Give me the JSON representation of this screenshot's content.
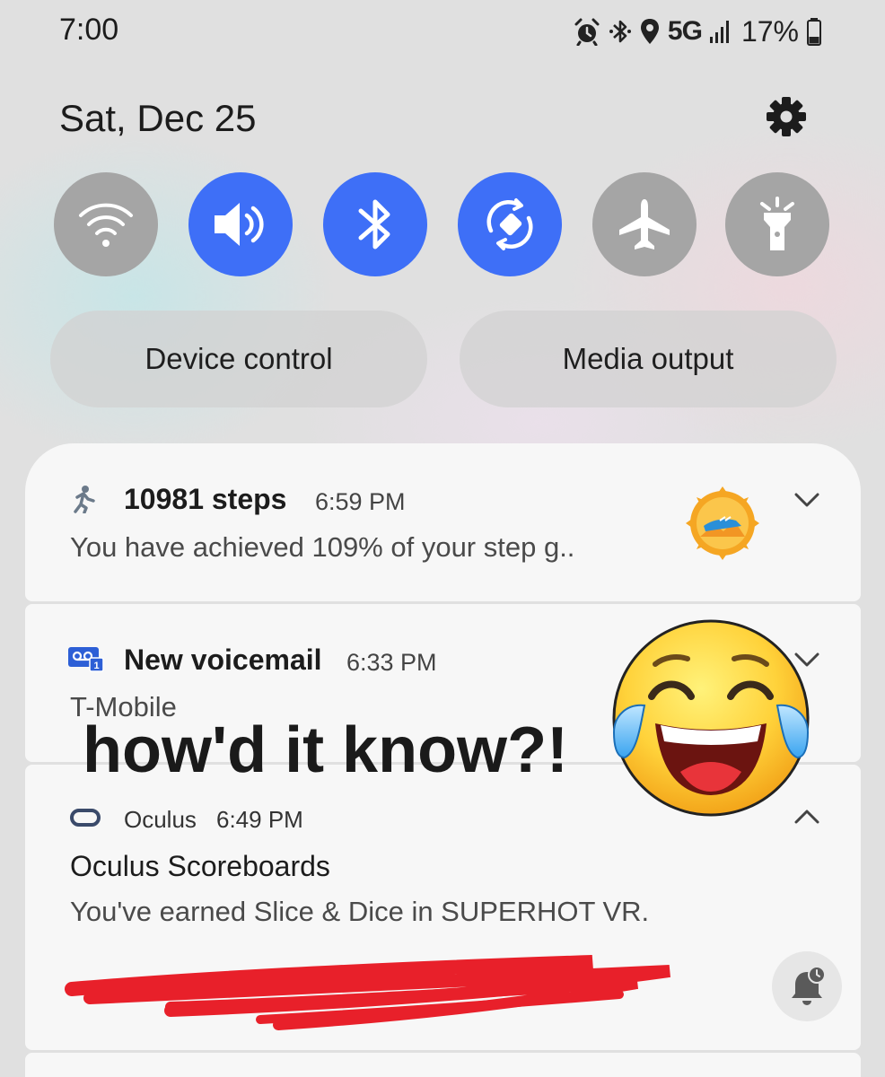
{
  "status_bar": {
    "time": "7:00",
    "network_type": "5G",
    "battery_percent": "17%",
    "icons": [
      "alarm-icon",
      "bluetooth-icon",
      "location-icon",
      "signal-icon",
      "battery-icon"
    ]
  },
  "header": {
    "date": "Sat, Dec 25",
    "settings_icon": "gear-icon"
  },
  "quick_toggles": [
    {
      "icon": "wifi-icon",
      "state": "off"
    },
    {
      "icon": "sound-icon",
      "state": "on"
    },
    {
      "icon": "bluetooth-icon",
      "state": "on"
    },
    {
      "icon": "auto-rotate-icon",
      "state": "on"
    },
    {
      "icon": "airplane-icon",
      "state": "off"
    },
    {
      "icon": "flashlight-icon",
      "state": "off"
    }
  ],
  "pills": {
    "device_control": "Device control",
    "media_output": "Media output"
  },
  "notifications": [
    {
      "app_icon": "running-person-icon",
      "title": "10981 steps",
      "time": "6:59 PM",
      "body": "You have achieved 109% of your step g..",
      "badge_icon": "achievement-badge-icon"
    },
    {
      "app_icon": "voicemail-icon",
      "title": "New voicemail",
      "time": "6:33 PM",
      "body": "T-Mobile"
    },
    {
      "app_icon": "oculus-icon",
      "app_name": "Oculus",
      "time": "6:49 PM",
      "title": "Oculus Scoreboards",
      "body": "You've earned Slice & Dice in SUPERHOT VR."
    }
  ],
  "overlay": {
    "caption": "how'd it know?!",
    "emoji_icon": "tears-of-joy-emoji"
  },
  "colors": {
    "toggle_on": "#3e6ff7",
    "toggle_off": "#a5a5a5",
    "scribble": "#e8202a"
  }
}
